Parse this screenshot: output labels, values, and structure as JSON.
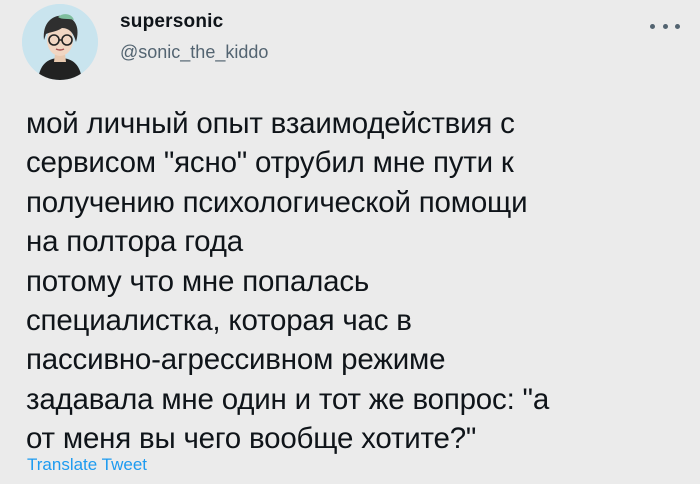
{
  "author": {
    "name": "supersonic",
    "handle": "@sonic_the_kiddo"
  },
  "icons": {
    "avatar": "user-avatar-illustration",
    "more": "more-options-icon"
  },
  "tweet": {
    "text": "мой личный опыт взаимодействия с\nсервисом \"ясно\" отрубил мне пути к\nполучению психологической помощи\nна полтора года\nпотому что мне попалась\nспециалистка, которая час в\nпассивно-агрессивном режиме\nзадавала мне один и тот же вопрос: \"а\nот меня вы чего вообще хотите?\""
  },
  "actions": {
    "translate_label": "Translate Tweet"
  },
  "colors": {
    "background": "#ebebeb",
    "link": "#1d9bf0",
    "secondary_text": "#536471",
    "avatar_bg": "#c9e4ee"
  }
}
